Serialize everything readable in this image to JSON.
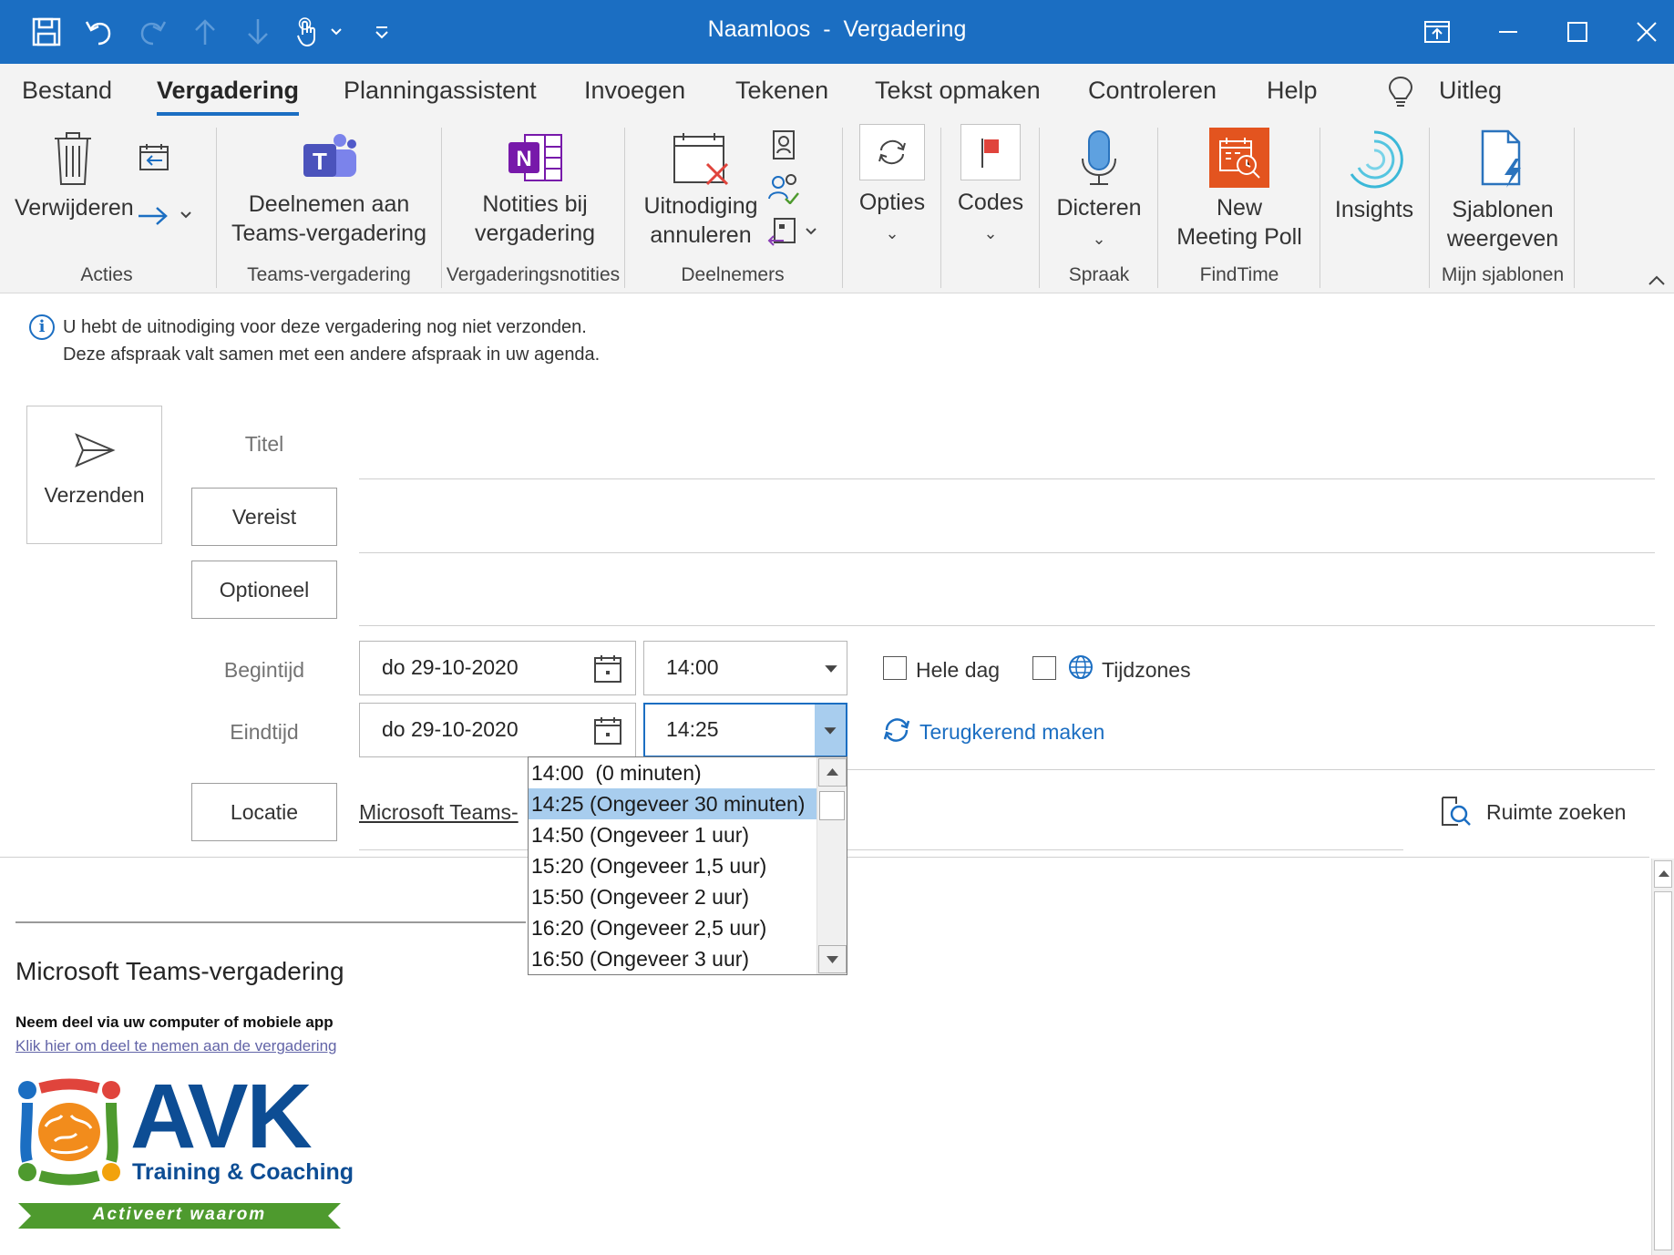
{
  "window": {
    "title_name": "Naamloos",
    "title_sep": "-",
    "title_type": "Vergadering"
  },
  "tabs": [
    "Bestand",
    "Vergadering",
    "Planningassistent",
    "Invoegen",
    "Tekenen",
    "Tekst opmaken",
    "Controleren",
    "Help"
  ],
  "tell_me": "Uitleg",
  "ribbon": {
    "delete": "Verwijderen",
    "teams_line1": "Deelnemen aan",
    "teams_line2": "Teams-vergadering",
    "notes_line1": "Notities bij",
    "notes_line2": "vergadering",
    "cancel_line1": "Uitnodiging",
    "cancel_line2": "annuleren",
    "options": "Opties",
    "codes": "Codes",
    "dictate": "Dicteren",
    "poll_line1": "New",
    "poll_line2": "Meeting Poll",
    "insights": "Insights",
    "templates_line1": "Sjablonen",
    "templates_line2": "weergeven",
    "groups": {
      "actions": "Acties",
      "teams": "Teams-vergadering",
      "notes": "Vergaderingsnotities",
      "attendees": "Deelnemers",
      "speech": "Spraak",
      "findtime": "FindTime",
      "templates": "Mijn sjablonen"
    }
  },
  "info": {
    "line1": "U hebt de uitnodiging voor deze vergadering nog niet verzonden.",
    "line2": "Deze afspraak valt samen met een andere afspraak in uw agenda."
  },
  "form": {
    "send": "Verzenden",
    "title_label": "Titel",
    "required": "Vereist",
    "optional": "Optioneel",
    "start_label": "Begintijd",
    "end_label": "Eindtijd",
    "start_date": "do 29-10-2020",
    "start_time": "14:00",
    "end_date": "do 29-10-2020",
    "end_time": "14:25",
    "all_day": "Hele dag",
    "time_zones": "Tijdzones",
    "recurring": "Terugkerend maken",
    "location": "Locatie",
    "location_value": "Microsoft Teams-",
    "room_finder": "Ruimte zoeken"
  },
  "dropdown": {
    "items": [
      "14:00  (0 minuten)",
      "14:25 (Ongeveer 30 minuten)",
      "14:50 (Ongeveer 1 uur)",
      "15:20 (Ongeveer 1,5 uur)",
      "15:50 (Ongeveer 2 uur)",
      "16:20 (Ongeveer 2,5 uur)",
      "16:50 (Ongeveer 3 uur)"
    ],
    "selected_index": 1
  },
  "body": {
    "heading": "Microsoft Teams-vergadering",
    "join_text": "Neem deel via uw computer of mobiele app",
    "join_link": "Klik hier om deel te nemen aan de vergadering",
    "logo_main": "AVK",
    "logo_sub": "Training & Coaching",
    "logo_tagline": "Activeert waarom"
  },
  "colors": {
    "accent": "#1b6ec2",
    "selection": "#a8cdee",
    "logo_blue": "#0d4d94",
    "logo_green": "#4e9a2e",
    "teams_purple": "#6264a7",
    "onenote_purple": "#7719aa",
    "findtime_orange": "#e3541f"
  }
}
